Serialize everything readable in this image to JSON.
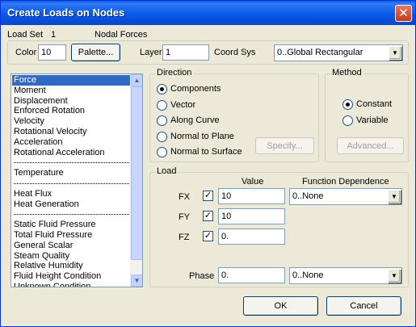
{
  "window": {
    "title": "Create Loads on Nodes",
    "close_glyph": "✕"
  },
  "header": {
    "load_set_label": "Load Set",
    "load_set_value": "1",
    "load_set_type": "Nodal Forces"
  },
  "props": {
    "color_label": "Color",
    "color_value": "10",
    "palette_label": "Palette...",
    "layer_label": "Layer",
    "layer_value": "1",
    "coord_label": "Coord Sys",
    "coord_value": "0..Global Rectangular"
  },
  "load_types": {
    "selected": "Force",
    "groups": [
      [
        "Force",
        "Moment",
        "Displacement",
        "Enforced Rotation",
        "Velocity",
        "Rotational Velocity",
        "Acceleration",
        "Rotational Acceleration"
      ],
      [
        "Temperature"
      ],
      [
        "Heat Flux",
        "Heat Generation"
      ],
      [
        "Static Fluid Pressure",
        "Total Fluid Pressure",
        "General Scalar",
        "Steam Quality",
        "Relative Humidity",
        "Fluid Height Condition",
        "Unknown Condition"
      ]
    ]
  },
  "direction": {
    "title": "Direction",
    "options": [
      "Components",
      "Vector",
      "Along Curve",
      "Normal to Plane",
      "Normal to Surface"
    ],
    "selected": "Components",
    "specify_label": "Specify..."
  },
  "method": {
    "title": "Method",
    "options": [
      "Constant",
      "Variable"
    ],
    "selected": "Constant",
    "advanced_label": "Advanced..."
  },
  "load": {
    "title": "Load",
    "value_header": "Value",
    "function_header": "Function Dependence",
    "rows": [
      {
        "label": "FX",
        "checked": true,
        "value": "10",
        "function": "0..None"
      },
      {
        "label": "FY",
        "checked": true,
        "value": "10",
        "function": ""
      },
      {
        "label": "FZ",
        "checked": true,
        "value": "0.",
        "function": ""
      }
    ],
    "phase_label": "Phase",
    "phase_value": "0.",
    "phase_function": "0..None"
  },
  "footer": {
    "ok_label": "OK",
    "cancel_label": "Cancel"
  },
  "glyphs": {
    "check": "✓",
    "dropdown": "▼",
    "scroll_up": "▲",
    "scroll_down": "▼"
  }
}
